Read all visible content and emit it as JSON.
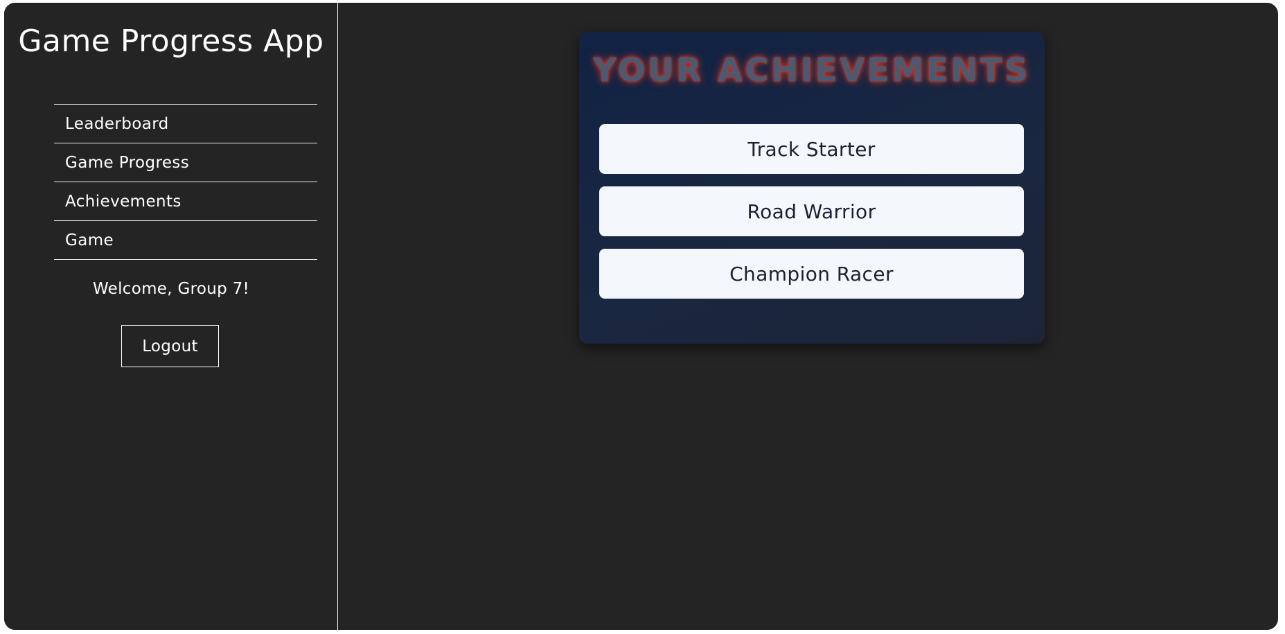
{
  "app": {
    "title": "Game Progress App"
  },
  "sidebar": {
    "items": [
      {
        "label": "Leaderboard"
      },
      {
        "label": "Game Progress"
      },
      {
        "label": "Achievements"
      },
      {
        "label": "Game"
      }
    ],
    "welcome": "Welcome, Group 7!",
    "logout_label": "Logout"
  },
  "main": {
    "card": {
      "title": "YOUR ACHIEVEMENTS",
      "achievements": [
        {
          "label": "Track Starter"
        },
        {
          "label": "Road Warrior"
        },
        {
          "label": "Champion Racer"
        }
      ]
    }
  },
  "colors": {
    "background": "#242424",
    "card": "#13223f",
    "achievement_bg": "#f4f7fb",
    "title_glow": "#c0392b",
    "text": "#ffffff"
  }
}
